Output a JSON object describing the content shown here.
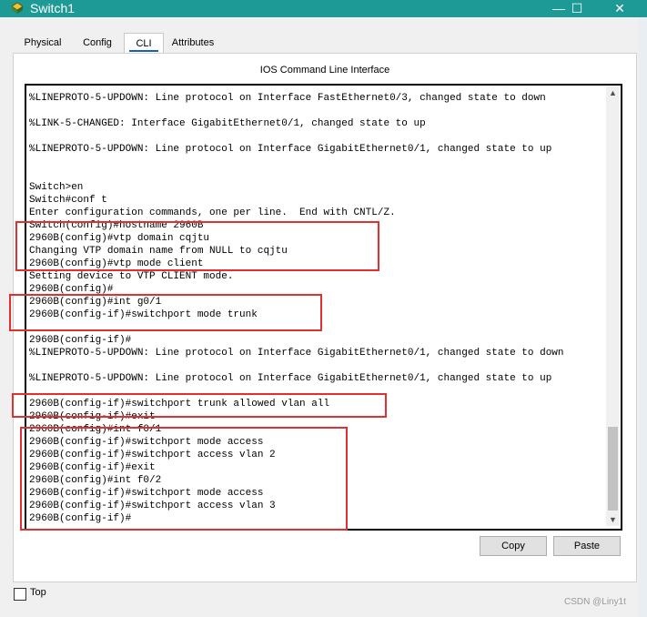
{
  "window": {
    "title": "Switch1",
    "icon": "network-device-icon",
    "controls": {
      "minimize": "—",
      "maximize": "☐",
      "close": "✕"
    }
  },
  "tabs": [
    {
      "label": "Physical",
      "active": false
    },
    {
      "label": "Config",
      "active": false
    },
    {
      "label": "CLI",
      "active": true
    },
    {
      "label": "Attributes",
      "active": false
    }
  ],
  "panel": {
    "title": "IOS Command Line Interface"
  },
  "terminal": {
    "lines": [
      "%LINEPROTO-5-UPDOWN: Line protocol on Interface FastEthernet0/3, changed state to down",
      "",
      "%LINK-5-CHANGED: Interface GigabitEthernet0/1, changed state to up",
      "",
      "%LINEPROTO-5-UPDOWN: Line protocol on Interface GigabitEthernet0/1, changed state to up",
      "",
      "",
      "Switch>en",
      "Switch#conf t",
      "Enter configuration commands, one per line.  End with CNTL/Z.",
      "Switch(config)#hostname 2960B",
      "2960B(config)#vtp domain cqjtu",
      "Changing VTP domain name from NULL to cqjtu",
      "2960B(config)#vtp mode client",
      "Setting device to VTP CLIENT mode.",
      "2960B(config)#",
      "2960B(config)#int g0/1",
      "2960B(config-if)#switchport mode trunk",
      "",
      "2960B(config-if)#",
      "%LINEPROTO-5-UPDOWN: Line protocol on Interface GigabitEthernet0/1, changed state to down",
      "",
      "%LINEPROTO-5-UPDOWN: Line protocol on Interface GigabitEthernet0/1, changed state to up",
      "",
      "2960B(config-if)#switchport trunk allowed vlan all",
      "2960B(config-if)#exit",
      "2960B(config)#int f0/1",
      "2960B(config-if)#switchport mode access",
      "2960B(config-if)#switchport access vlan 2",
      "2960B(config-if)#exit",
      "2960B(config)#int f0/2",
      "2960B(config-if)#switchport mode access",
      "2960B(config-if)#switchport access vlan 3",
      "2960B(config-if)#"
    ]
  },
  "scrollbar": {
    "up": "▲",
    "down": "▼"
  },
  "buttons": {
    "copy": "Copy",
    "paste": "Paste"
  },
  "top_checkbox": {
    "label": "Top",
    "checked": false
  },
  "watermark": "CSDN @Liny1t",
  "colors": {
    "titlebar": "#1e9a96",
    "highlight": "#e03030"
  }
}
